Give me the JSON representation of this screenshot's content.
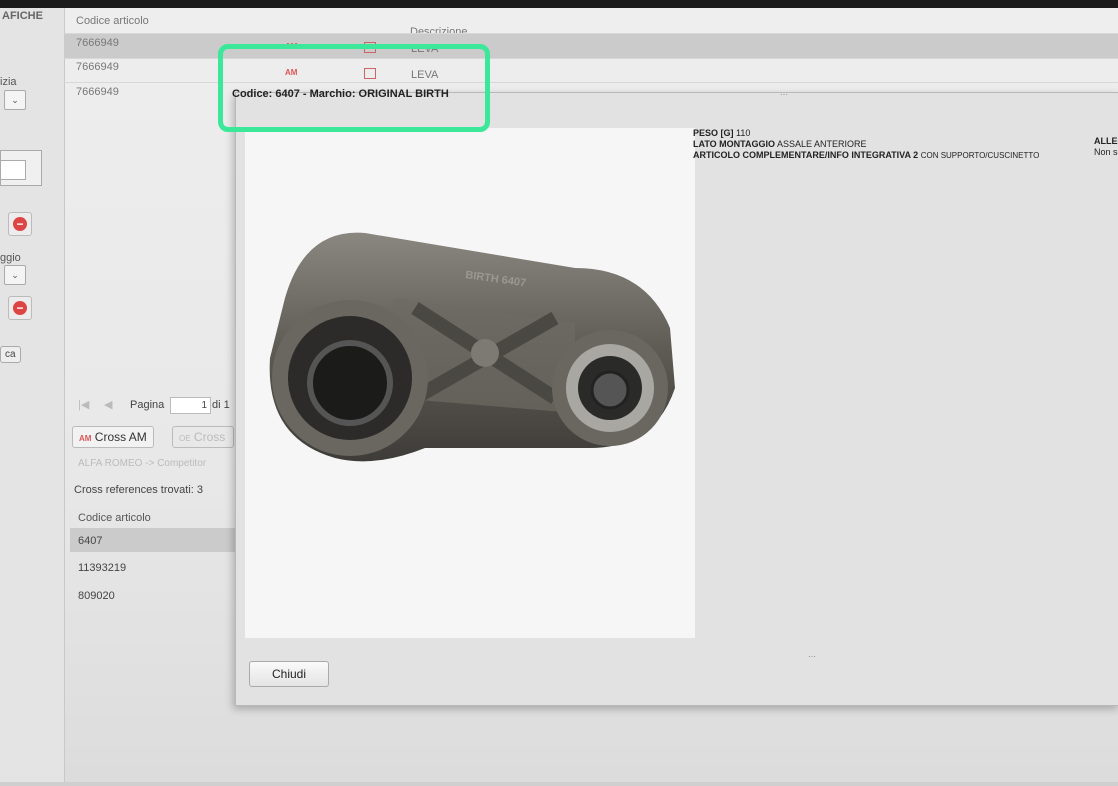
{
  "left_panel": {
    "title": "AFICHE",
    "label_1": "izia",
    "label_2": "ggio",
    "button_label": "ca"
  },
  "list": {
    "col_code": "Codice articolo",
    "col_desc": "Descrizione",
    "rows": [
      {
        "code": "7666949",
        "brand": "AM",
        "desc": "LEVA"
      },
      {
        "code": "7666949",
        "brand": "AM",
        "desc": "LEVA"
      },
      {
        "code": "7666949",
        "brand": "",
        "desc": ""
      }
    ]
  },
  "pager": {
    "label": "Pagina",
    "page": "1",
    "of": "di 1"
  },
  "cross": {
    "tab_am": "Cross AM",
    "tab_oe_tag": "OE",
    "tab_oe": "Cross",
    "am_tag": "AM",
    "combo": "ALFA ROMEO -> Competitor",
    "found": "Cross references trovati: 3",
    "col_code": "Codice articolo",
    "rows": [
      "6407",
      "11393219",
      "809020"
    ]
  },
  "popup": {
    "title": "Codice: 6407 - Marchio: ORIGINAL BIRTH",
    "specs": [
      {
        "key": "PESO [G]",
        "value": "110"
      },
      {
        "key": "LATO MONTAGGIO",
        "value": "ASSALE ANTERIORE"
      },
      {
        "key": "ARTICOLO COMPLEMENTARE/INFO INTEGRATIVA 2",
        "value": "CON SUPPORTO/CUSCINETTO"
      }
    ],
    "attachments_label": "ALLEG",
    "attachments_value": "Non sc",
    "close_label": "Chiudi",
    "part_marking": "BIRTH 6407"
  },
  "colors": {
    "highlight": "#3be89a",
    "accent": "#d44444"
  }
}
